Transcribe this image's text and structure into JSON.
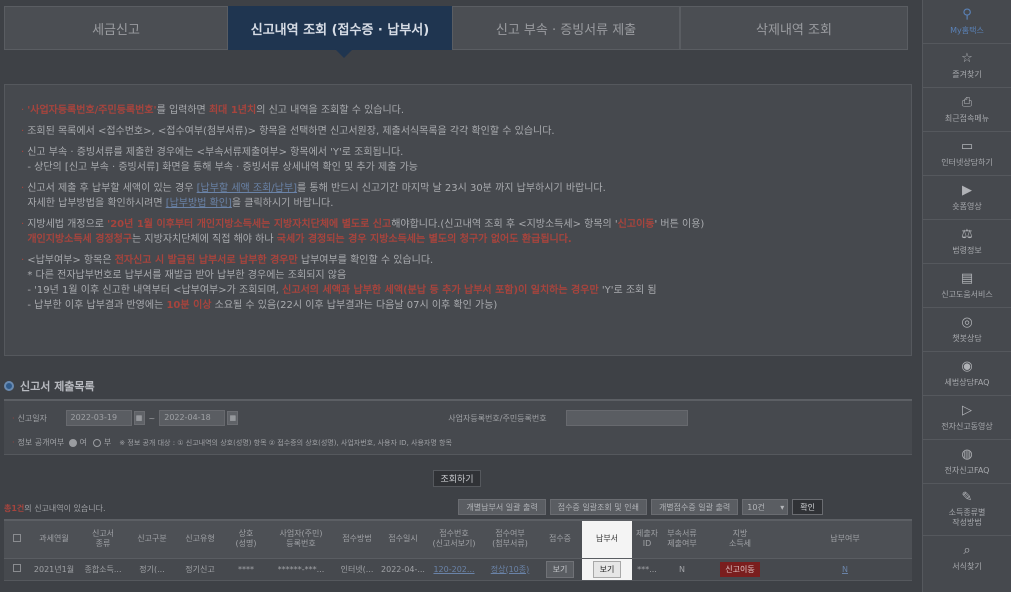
{
  "tabs": [
    "세금신고",
    "신고내역 조회 (접수증 · 납부서)",
    "신고 부속 · 증빙서류 제출",
    "삭제내역 조회"
  ],
  "notice": {
    "l1_a": "'사업자등록번호/주민등록번호'",
    "l1_b": "를 입력하면 ",
    "l1_c": "최대 1년치",
    "l1_d": "의 신고 내역을 조회할 수 있습니다.",
    "l2": "조회된 목록에서 <접수번호>, <접수여부(첨부서류)> 항목을 선택하면 신고서원장, 제출서식목록을 각각 확인할 수 있습니다.",
    "l3": "신고 부속 · 증빙서류를 제출한 경우에는 <부속서류제출여부> 항목에서 'Y'로 조회됩니다.",
    "l4": "- 상단의 [신고 부속 · 증빙서류] 화면을 통해 부속 · 증빙서류 상세내역 확인 및 추가 제출 가능",
    "l5_a": "신고서 제출 후 납부할 세액이 있는 경우 ",
    "l5_b": "[납부할 세액 조회/납부]",
    "l5_c": "를 통해 반드시 신고기간 마지막 날 23시 30분 까지 납부하시기 바랍니다.",
    "l6_a": "자세한 납부방법을 확인하시려면 ",
    "l6_b": "[납부방법 확인]",
    "l6_c": "을 클릭하시기 바랍니다.",
    "l7_a": "지방세법 개정으로 ",
    "l7_b": "'20년 1월 이후부터 개인지방소득세는 지방자치단체에 별도로 신고",
    "l7_c": "해야합니다.(신고내역 조회 후 <지방소득세> 항목의 '",
    "l7_d": "신고이동",
    "l7_e": "' 버튼 이용)",
    "l8_a": "개인지방소득세 경정청구",
    "l8_b": "는 지방자치단체에 직접 해야 하나 ",
    "l8_c": "국세가 경정되는 경우 지방소득세는 별도의 청구가 없어도 환급됩니다.",
    "l9_a": "<납부여부> 항목은 ",
    "l9_b": "전자신고 시 발급된 납부서로 납부한 경우만",
    "l9_c": " 납부여부를 확인할 수 있습니다.",
    "l10": "* 다른 전자납부번호로 납부서를 재발급 받아 납부한 경우에는 조회되지 않음",
    "l11_a": "- '19년 1월 이후 신고한 내역부터 <납부여부>가 조회되며, ",
    "l11_b": "신고서의 세액과 납부한 세액(분납 등 추가 납부서 포함)이 일치하는 경우만",
    "l11_c": " 'Y'로 조회 됨",
    "l12_a": "- 납부한 이후 납부결과 반영에는 ",
    "l12_b": "10분 이상",
    "l12_c": " 소요될 수 있음(22시 이후 납부결과는 다음날 07시 이후 확인 가능)"
  },
  "section_title": "신고서 제출목록",
  "filter": {
    "date_label": "신고일자",
    "date_from": "2022-03-19",
    "date_to": "2022-04-18",
    "tilde": "~",
    "biz_label": "사업자등록번호/주민등록번호",
    "open_label": "정보 공개여부",
    "yes": "여",
    "no": "부",
    "open_note": "※ 정보 공개 대상 : ① 신고내역의 상호(성명) 항목 ② 접수증의 상호(성명), 사업자번호, 사용자 ID, 사용자명 항목"
  },
  "search_button": "조회하기",
  "list": {
    "count_a": "총1건",
    "count_b": "의 신고내역이 있습니다.",
    "btn1": "개별납부서 일괄 출력",
    "btn2": "접수증 일괄조회 및 인쇄",
    "btn3": "개별접수증 일괄 출력",
    "page_size": "10건",
    "confirm": "확인"
  },
  "table": {
    "headers": [
      "",
      "과세연월",
      "신고서\n종류",
      "신고구분",
      "신고유형",
      "상호\n(성명)",
      "사업자(주민)\n등록번호",
      "접수방법",
      "접수일시",
      "접수번호\n(신고서보기)",
      "접수여부\n(첨부서류)",
      "접수증",
      "납부서",
      "제출자\nID",
      "부속서류\n제출여부",
      "지방\n소득세",
      "납부여부"
    ],
    "row": [
      "",
      "2021년1월",
      "종합소득...",
      "정기(...",
      "정기신고",
      "****",
      "******-***...",
      "인터넷(...",
      "2022-04-...",
      "120-202...",
      "정상(10종)",
      "보기",
      "보기",
      "***...",
      "N",
      "신고이동",
      "N"
    ]
  },
  "sidebar": [
    {
      "icon": "person-icon",
      "glyph": "⚲",
      "label": "My홈택스"
    },
    {
      "icon": "star-icon",
      "glyph": "☆",
      "label": "즐겨찾기"
    },
    {
      "icon": "recent-icon",
      "glyph": "⎙",
      "label": "최근접속메뉴"
    },
    {
      "icon": "monitor-icon",
      "glyph": "▭",
      "label": "인터넷상담하기"
    },
    {
      "icon": "play-icon",
      "glyph": "▶",
      "label": "숏폼영상"
    },
    {
      "icon": "gavel-icon",
      "glyph": "⚖",
      "label": "법령정보"
    },
    {
      "icon": "book-icon",
      "glyph": "▤",
      "label": "신고도움서비스"
    },
    {
      "icon": "headset-icon",
      "glyph": "◎",
      "label": "챗봇상담"
    },
    {
      "icon": "chat-icon",
      "glyph": "◉",
      "label": "세법상담FAQ"
    },
    {
      "icon": "video-icon",
      "glyph": "▷",
      "label": "전자신고동영상"
    },
    {
      "icon": "faq-icon",
      "glyph": "◍",
      "label": "전자신고FAQ"
    },
    {
      "icon": "edit-icon",
      "glyph": "✎",
      "label": "소득종류별\n작성방법"
    },
    {
      "icon": "search-icon",
      "glyph": "⌕",
      "label": "서식찾기"
    }
  ]
}
